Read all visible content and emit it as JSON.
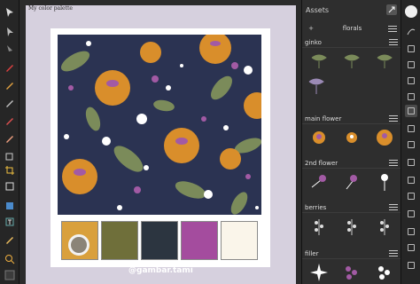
{
  "document": {
    "title": "My color palette",
    "handle": "@gambar.tami"
  },
  "palette": {
    "swatches": [
      "#d9a03c",
      "#6f6f3a",
      "#2c3540",
      "#a44c9e",
      "#faf5ea"
    ],
    "accent_ring": "#8b8478"
  },
  "assets_panel": {
    "title": "Assets",
    "category": "florals",
    "sections": [
      {
        "name": "ginko"
      },
      {
        "name": "main flower"
      },
      {
        "name": "2nd flower"
      },
      {
        "name": "berries"
      },
      {
        "name": "filler"
      }
    ]
  },
  "colors": {
    "pattern_bg": "#2b3352",
    "flower_orange": "#d98e2b",
    "leaf_green": "#7b8b5a",
    "purple": "#a25aa4",
    "white": "#ffffff"
  },
  "icons": {
    "left_toolbar": [
      "move-icon",
      "select-icon",
      "cursor-icon",
      "pen-icon",
      "brush-icon",
      "pencil-icon",
      "paint-brush-icon",
      "eraser-icon",
      "fill-icon",
      "crop-icon",
      "rectangle-icon",
      "shape-icon",
      "text-icon",
      "eyedropper-icon",
      "zoom-icon"
    ],
    "right_toolbar": [
      "color-circle-icon",
      "brush-stroke-icon",
      "layers-icon",
      "adjust-icon",
      "assets-icon",
      "stock-icon",
      "history-icon",
      "navigator-icon",
      "transform-icon",
      "effects-icon",
      "styles-icon",
      "grid-icon",
      "settings-icon"
    ]
  }
}
